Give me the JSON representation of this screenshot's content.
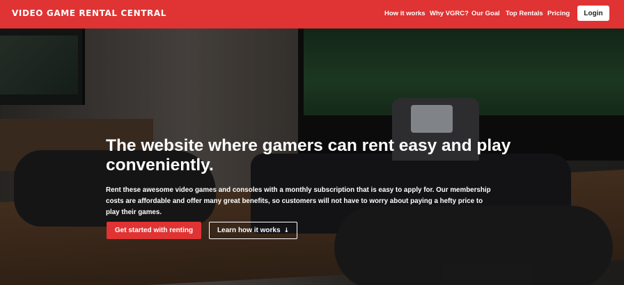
{
  "brand": {
    "name": "Video Game Rental Central"
  },
  "nav": {
    "links": [
      "How it works",
      "Why VGRC?",
      "Our Goal",
      "Top Rentals",
      "Pricing"
    ],
    "login_label": "Login"
  },
  "hero": {
    "title": "The website where gamers can rent easy and play conveniently.",
    "description": "Rent these awesome video games and consoles with a monthly subscription that is easy to apply for. Our membership costs are affordable and offer many great benefits, so customers will not have to worry about paying a hefty price to play their games.",
    "primary_cta": "Get started with renting",
    "secondary_cta": "Learn how it works",
    "secondary_cta_icon": "↓"
  },
  "colors": {
    "brand_red": "#e03333",
    "text_white": "#ffffff"
  }
}
